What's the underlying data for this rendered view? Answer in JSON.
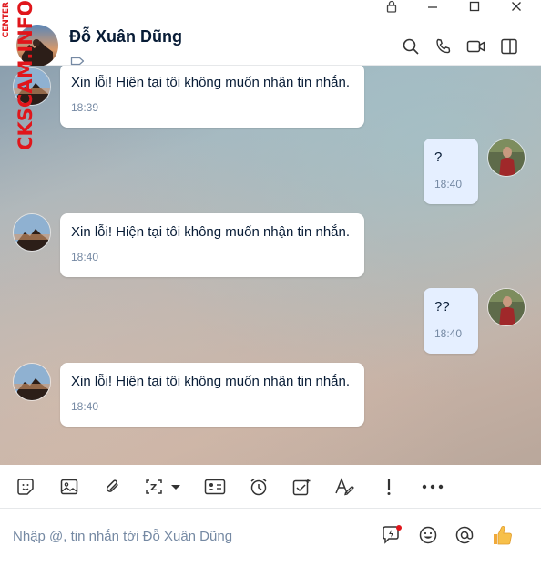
{
  "window": {
    "controls": [
      "lock-icon",
      "minimize-icon",
      "maximize-icon",
      "close-icon"
    ]
  },
  "header": {
    "contact_name": "Đỗ Xuân Dũng",
    "icons": [
      "search-icon",
      "phone-icon",
      "video-call-icon",
      "sidebar-toggle-icon"
    ]
  },
  "messages": [
    {
      "sender": "contact",
      "text": "Xin lỗi! Hiện tại tôi không muốn nhận tin nhắn.",
      "time": "18:39"
    },
    {
      "sender": "me",
      "text": "?",
      "time": "18:40"
    },
    {
      "sender": "contact",
      "text": "Xin lỗi! Hiện tại tôi không muốn nhận tin nhắn.",
      "time": "18:40"
    },
    {
      "sender": "me",
      "text": "??",
      "time": "18:40"
    },
    {
      "sender": "contact",
      "text": "Xin lỗi! Hiện tại tôi không muốn nhận tin nhắn.",
      "time": "18:40"
    }
  ],
  "toolbar": {
    "icons": [
      "sticker-icon",
      "image-icon",
      "attachment-icon",
      "screenshot-icon",
      "contact-card-icon",
      "reminder-icon",
      "task-icon",
      "text-format-icon",
      "important-icon",
      "more-icon"
    ]
  },
  "composer": {
    "placeholder": "Nhập @, tin nhắn tới Đỗ Xuân Dũng",
    "icons": [
      "quick-message-icon",
      "emoji-icon",
      "mention-icon",
      "thumbs-up-icon"
    ]
  },
  "watermark": {
    "main": "CKSCAM.INFO",
    "small": "CENTER"
  },
  "colors": {
    "accent": "#0068ff",
    "my_bubble": "#e5efff",
    "watermark": "#e0161b"
  }
}
